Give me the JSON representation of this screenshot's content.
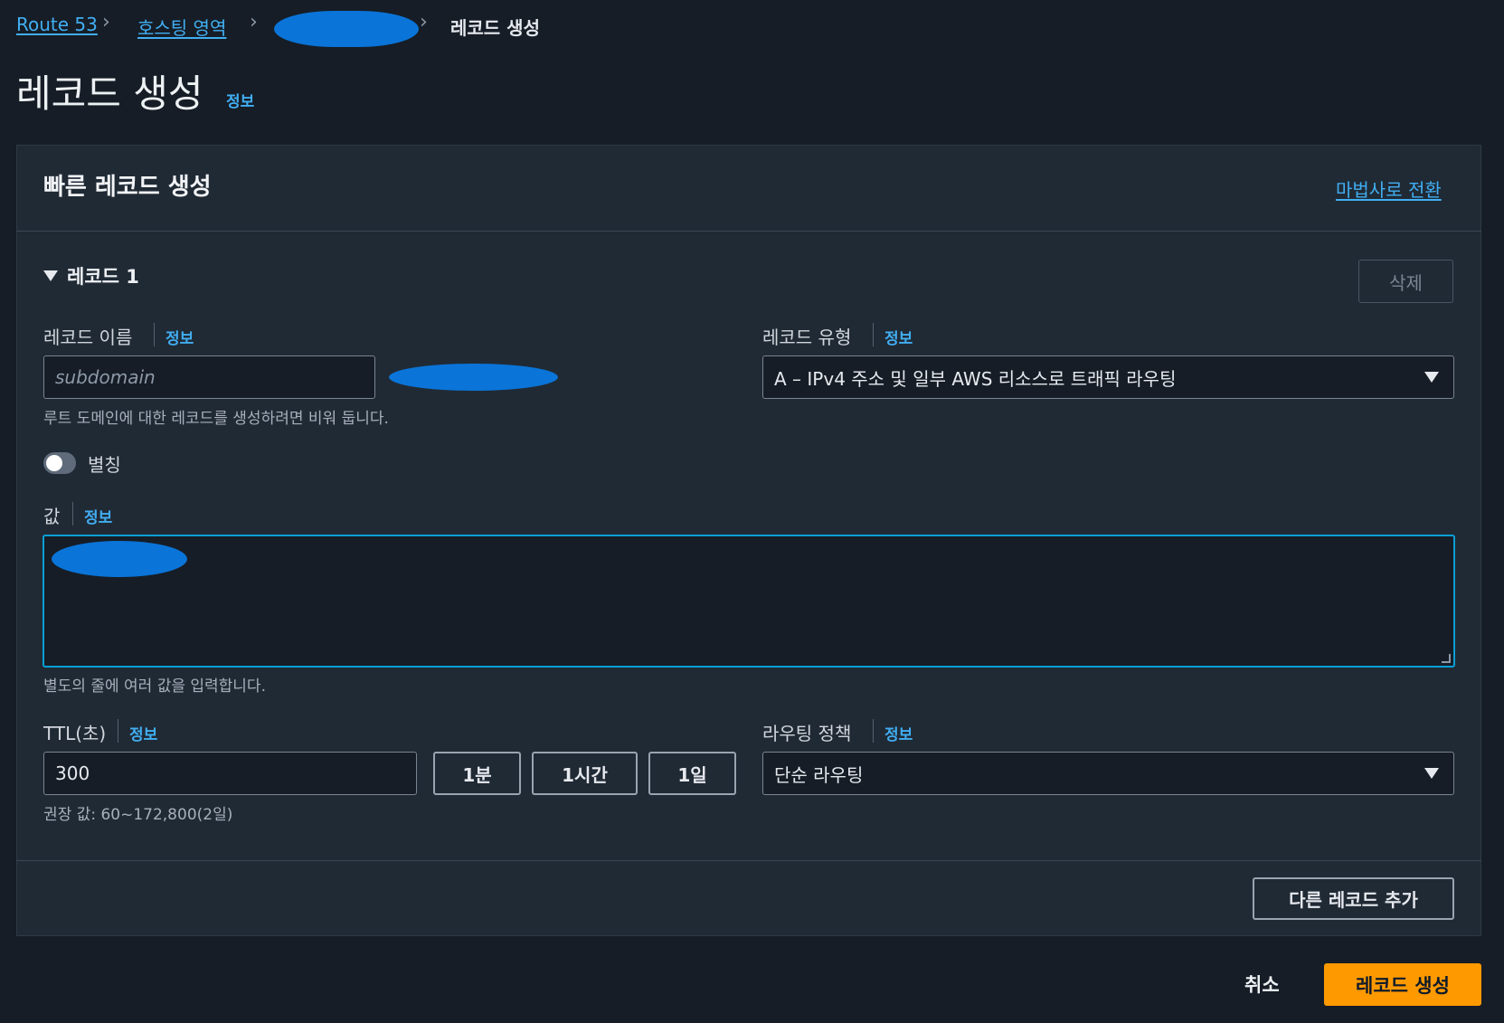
{
  "breadcrumb": {
    "items": [
      "Route 53",
      "호스팅 영역"
    ],
    "current": "레코드 생성"
  },
  "page": {
    "title": "레코드 생성",
    "info": "정보"
  },
  "panel": {
    "title": "빠른 레코드 생성",
    "wizard_link": "마법사로 전환",
    "record_header": "레코드 1",
    "delete_button": "삭제",
    "record_name": {
      "label": "레코드 이름",
      "info": "정보",
      "placeholder": "subdomain",
      "hint": "루트 도메인에 대한 레코드를 생성하려면 비워 둡니다."
    },
    "record_type": {
      "label": "레코드 유형",
      "info": "정보",
      "selected": "A – IPv4 주소 및 일부 AWS 리소스로 트래픽 라우팅"
    },
    "alias": {
      "label": "별칭",
      "enabled": false
    },
    "value": {
      "label": "값",
      "info": "정보",
      "hint": "별도의 줄에 여러 값을 입력합니다."
    },
    "ttl": {
      "label": "TTL(초)",
      "info": "정보",
      "value": "300",
      "presets": [
        "1분",
        "1시간",
        "1일"
      ],
      "hint": "권장 값: 60~172,800(2일)"
    },
    "routing_policy": {
      "label": "라우팅 정책",
      "info": "정보",
      "selected": "단순 라우팅"
    },
    "add_record_button": "다른 레코드 추가"
  },
  "footer": {
    "cancel": "취소",
    "create": "레코드 생성"
  },
  "colors": {
    "background": "#161d26",
    "panel": "#202a35",
    "link": "#41aef2",
    "primary": "#ff9900",
    "focus": "#0a9fd6",
    "redaction": "#0a74d8"
  }
}
